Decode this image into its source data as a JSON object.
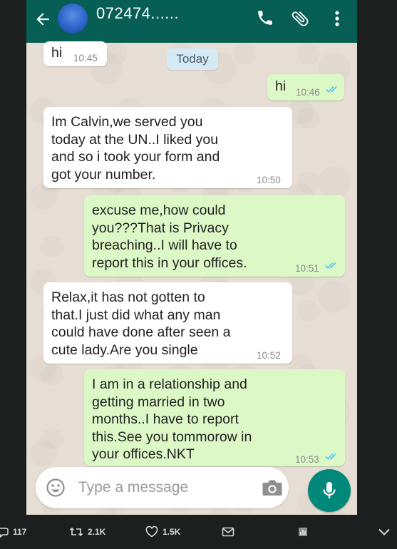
{
  "chat": {
    "contact_name": "072474......",
    "date_chip": "Today",
    "messages": [
      {
        "direction": "in",
        "text": "hi",
        "time": "10:45"
      },
      {
        "direction": "out",
        "text": "hi",
        "time": "10:46",
        "status": "read"
      },
      {
        "direction": "in",
        "text": "Im Calvin,we served you\ntoday at the UN..I liked you\nand so i took your form and\ngot your number.",
        "time": "10:50"
      },
      {
        "direction": "out",
        "text": "excuse me,how could\nyou???That is Privacy\nbreaching..I will have to\nreport this in your offices.",
        "time": "10:51",
        "status": "read"
      },
      {
        "direction": "in",
        "text": "Relax,it has not gotten to\nthat.I just did what any man\ncould have done after seen a\ncute lady.Are you single",
        "time": "10:52"
      },
      {
        "direction": "out",
        "text": "I am in a relationship and\ngetting married in two\nmonths..I have to report\nthis.See you tommorow in\nyour offices.NKT",
        "time": "10:53",
        "status": "read"
      }
    ],
    "input_placeholder": "Type a message"
  },
  "icons": {
    "back": "arrow-left-icon",
    "call": "phone-icon",
    "attach": "paperclip-icon",
    "more": "more-vertical-icon",
    "emoji": "emoji-icon",
    "camera": "camera-icon",
    "mic": "microphone-icon"
  },
  "tweet_actions": {
    "replies": "117",
    "retweets": "2.1K",
    "likes": "1.5K"
  },
  "colors": {
    "header": "#075e54",
    "outgoing_bubble": "#dcf8c6",
    "incoming_bubble": "#ffffff",
    "read_ticks": "#4fc3f7",
    "mic_button": "#00897b"
  }
}
